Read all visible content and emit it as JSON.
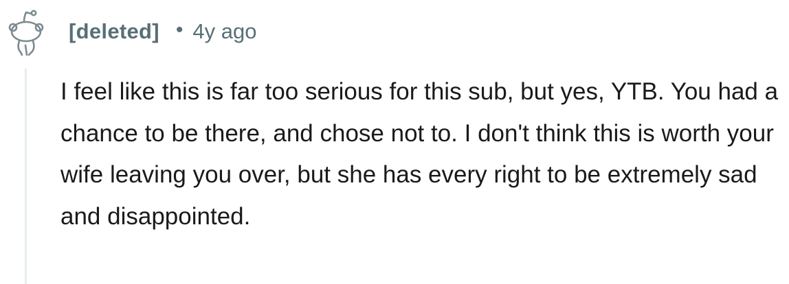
{
  "comment": {
    "author": "[deleted]",
    "separator": "•",
    "timestamp": "4y ago",
    "avatar_icon": "snoo-avatar-icon",
    "body": "I feel like this is far too serious for this sub, but yes, YTB. You had a chance to be there, and chose not to. I don't think this is worth your wife leaving you over, but she has every right to be extremely sad and disappointed."
  },
  "colors": {
    "meta_text": "#576f76",
    "body_text": "#1a1a1b",
    "thread_line": "#e5ebee",
    "avatar_stroke": "#7c8a90"
  }
}
